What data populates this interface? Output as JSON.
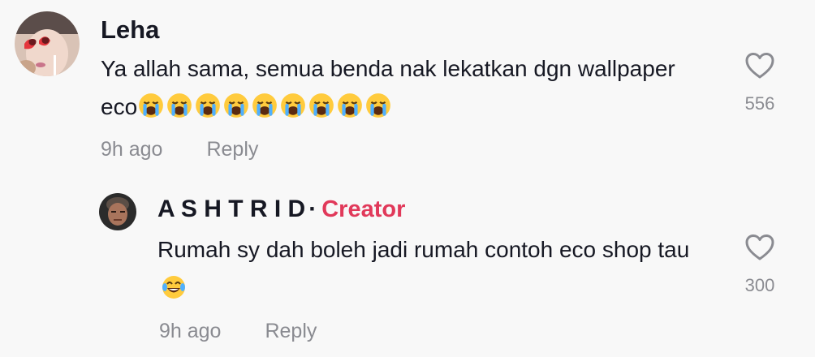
{
  "comments": [
    {
      "username": "Leha",
      "text": "Ya allah sama, semua benda nak lekatkan dgn wallpaper eco",
      "emoji_suffix": "loudly-crying-face x9",
      "time": "9h ago",
      "reply_label": "Reply",
      "likes": "556",
      "icons": {
        "like": "heart-outline-icon",
        "emoji": "loudly-crying-face"
      }
    },
    {
      "username": "A S H T R I D",
      "separator": "·",
      "badge": "Creator",
      "text": "Rumah sy dah boleh jadi rumah contoh eco shop tau",
      "emoji_suffix": "face-with-tears-of-joy",
      "time": "9h ago",
      "reply_label": "Reply",
      "likes": "300",
      "icons": {
        "like": "heart-outline-icon",
        "emoji": "face-with-tears-of-joy"
      }
    }
  ],
  "colors": {
    "background": "#f8f8f8",
    "text": "#161823",
    "muted": "#8a8b91",
    "creator_badge": "#e1395a"
  }
}
